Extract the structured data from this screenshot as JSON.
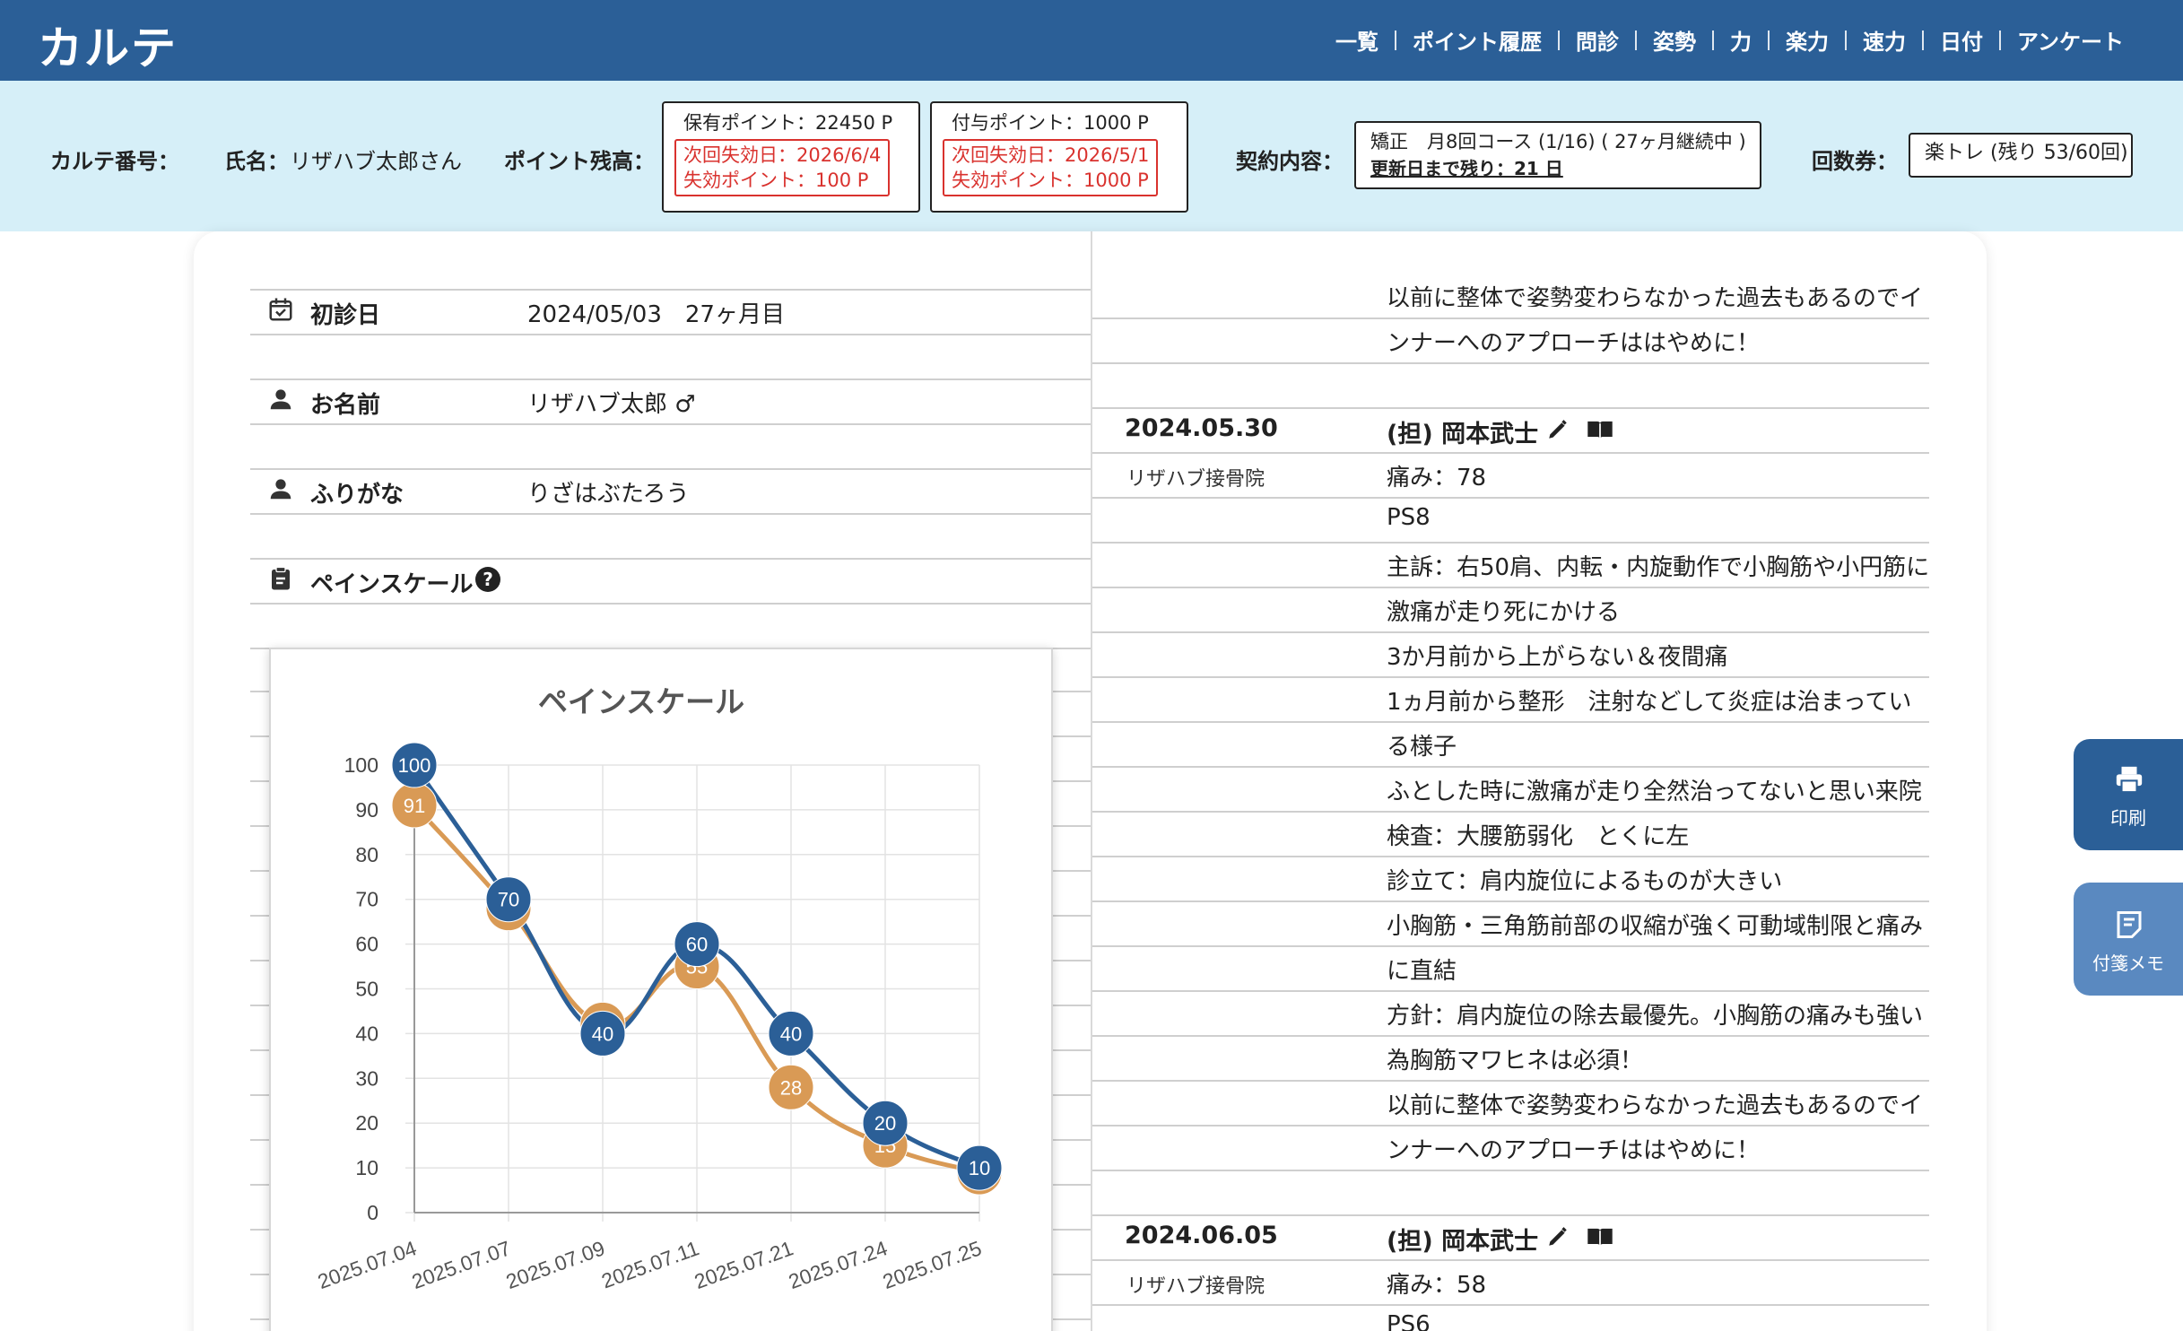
{
  "app": {
    "title": "カルテ"
  },
  "nav": [
    {
      "label": "一覧"
    },
    {
      "label": "ポイント履歴"
    },
    {
      "label": "問診"
    },
    {
      "label": "姿勢"
    },
    {
      "label": "力"
    },
    {
      "label": "楽力"
    },
    {
      "label": "速力"
    },
    {
      "label": "日付"
    },
    {
      "label": "アンケート"
    }
  ],
  "infobar": {
    "chart_no_label": "カルテ番号：",
    "name_label": "氏名：",
    "name_value": "リザハブ太郎さん",
    "points_label": "ポイント残高：",
    "held": {
      "title": "保有ポイント：22450 P",
      "expiry": "次回失効日：2026/6/4",
      "expire_points": "失効ポイント：100 P"
    },
    "granted": {
      "title": "付与ポイント：1000 P",
      "expiry": "次回失効日：2026/5/1",
      "expire_points": "失効ポイント：1000 P"
    },
    "contract_label": "契約内容：",
    "contract_line1": "矯正　月8回コース (1/16) ( 27ヶ月継続中 )",
    "contract_line2": "更新日まで残り：21 日",
    "ticket_label": "回数券：",
    "ticket_value": "楽トレ (残り 53/60回)"
  },
  "profile": {
    "first_visit_label": "初診日",
    "first_visit_value": "2024/05/03　27ヶ月目",
    "name_label": "お名前",
    "name_value": "リザハブ太郎 ♂",
    "kana_label": "ふりがな",
    "kana_value": "りざはぶたろう",
    "pain_label": "ペインスケール",
    "help_icon": "?"
  },
  "chart_data": {
    "type": "line",
    "title": "ペインスケール",
    "categories": [
      "2025.07.04",
      "2025.07.07",
      "2025.07.09",
      "2025.07.11",
      "2025.07.21",
      "2025.07.24",
      "2025.07.25"
    ],
    "series": [
      {
        "values": [
          91,
          68,
          42,
          55,
          28,
          15,
          9
        ],
        "color": "#d99a55"
      },
      {
        "values": [
          100,
          70,
          40,
          60,
          40,
          20,
          10
        ],
        "color": "#2b5f97"
      }
    ],
    "yticks": [
      "0",
      "10",
      "20",
      "30",
      "40",
      "50",
      "60",
      "70",
      "80",
      "90",
      "100"
    ],
    "ylim": [
      0,
      100
    ],
    "grid": true
  },
  "records": {
    "top_partial": "以前に整体で姿勢変わらなかった過去もあるのでイ",
    "top_partial2": "ンナーへのアプローチははやめに！",
    "r1": {
      "date": "2024.05.30",
      "staff": "(担) 岡本武士",
      "clinic": "リザハブ接骨院",
      "lines": [
        "痛み：78",
        "PS8",
        "主訴：右50肩、内転・内旋動作で小胸筋や小円筋に",
        "激痛が走り死にかける",
        "3か月前から上がらない＆夜間痛",
        "1ヵ月前から整形　注射などして炎症は治まってい",
        "る様子",
        "ふとした時に激痛が走り全然治ってないと思い来院",
        "検査：大腰筋弱化　とくに左",
        "診立て：肩内旋位によるものが大きい",
        "小胸筋・三角筋前部の収縮が強く可動域制限と痛み",
        "に直結",
        "方針：肩内旋位の除去最優先。小胸筋の痛みも強い",
        "為胸筋マワヒネは必須！",
        "以前に整体で姿勢変わらなかった過去もあるのでイ",
        "ンナーへのアプローチははやめに！"
      ]
    },
    "r2": {
      "date": "2024.06.05",
      "staff": "(担) 岡本武士",
      "clinic": "リザハブ接骨院",
      "lines": [
        "痛み：58",
        "PS6"
      ]
    }
  },
  "buttons": {
    "print": "印刷",
    "memo": "付箋メモ"
  }
}
